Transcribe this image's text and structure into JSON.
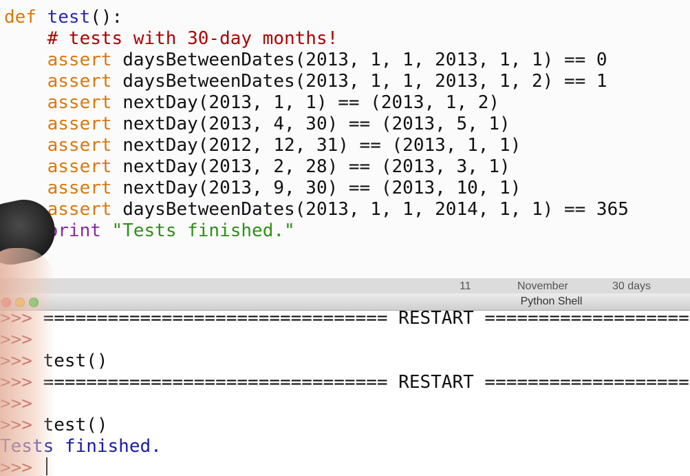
{
  "editor": {
    "lines": [
      {
        "parts": [
          {
            "t": "def ",
            "c": "kw"
          },
          {
            "t": "test",
            "c": "fn"
          },
          {
            "t": "():",
            "c": ""
          }
        ]
      },
      {
        "parts": [
          {
            "t": "    # tests with 30-day months!",
            "c": "cm"
          }
        ]
      },
      {
        "parts": [
          {
            "t": "    assert ",
            "c": "kw"
          },
          {
            "t": "daysBetweenDates(2013, 1, 1, 2013, 1, 1) == 0",
            "c": ""
          }
        ]
      },
      {
        "parts": [
          {
            "t": "    assert ",
            "c": "kw"
          },
          {
            "t": "daysBetweenDates(2013, 1, 1, 2013, 1, 2) == 1",
            "c": ""
          }
        ]
      },
      {
        "parts": [
          {
            "t": "    assert ",
            "c": "kw"
          },
          {
            "t": "nextDay(2013, 1, 1) == (2013, 1, 2)",
            "c": ""
          }
        ]
      },
      {
        "parts": [
          {
            "t": "    assert ",
            "c": "kw"
          },
          {
            "t": "nextDay(2013, 4, 30) == (2013, 5, 1)",
            "c": ""
          }
        ]
      },
      {
        "parts": [
          {
            "t": "    assert ",
            "c": "kw"
          },
          {
            "t": "nextDay(2012, 12, 31) == (2013, 1, 1)",
            "c": ""
          }
        ]
      },
      {
        "parts": [
          {
            "t": "    assert ",
            "c": "kw"
          },
          {
            "t": "nextDay(2013, 2, 28) == (2013, 3, 1)",
            "c": ""
          }
        ]
      },
      {
        "parts": [
          {
            "t": "    assert ",
            "c": "kw"
          },
          {
            "t": "nextDay(2013, 9, 30) == (2013, 10, 1)",
            "c": ""
          }
        ]
      },
      {
        "parts": [
          {
            "t": "    assert ",
            "c": "kw"
          },
          {
            "t": "daysBetweenDates(2013, 1, 1, 2014, 1, 1) == 365",
            "c": ""
          }
        ]
      },
      {
        "parts": [
          {
            "t": "    print ",
            "c": "kw-print"
          },
          {
            "t": "\"Tests finished.\"",
            "c": "str"
          }
        ]
      }
    ]
  },
  "background_window": {
    "texts": [
      "11",
      "November",
      "30 days"
    ]
  },
  "shell_window": {
    "title": "Python Shell",
    "traffic_light_colors": [
      "#f25f57",
      "#f7be2e",
      "#2fc840"
    ],
    "lines": [
      {
        "prompt": ">>> ",
        "text": "================================ RESTART ================================",
        "c": ""
      },
      {
        "prompt": ">>> ",
        "text": "",
        "c": ""
      },
      {
        "prompt": ">>> ",
        "text": "test()",
        "c": ""
      },
      {
        "prompt": ">>> ",
        "text": "================================ RESTART ================================",
        "c": ""
      },
      {
        "prompt": ">>> ",
        "text": "",
        "c": ""
      },
      {
        "prompt": ">>> ",
        "text": "test()",
        "c": ""
      },
      {
        "prompt": "",
        "text": "Tests finished.",
        "c": "out"
      },
      {
        "prompt": ">>> ",
        "text": "",
        "c": ""
      }
    ]
  }
}
